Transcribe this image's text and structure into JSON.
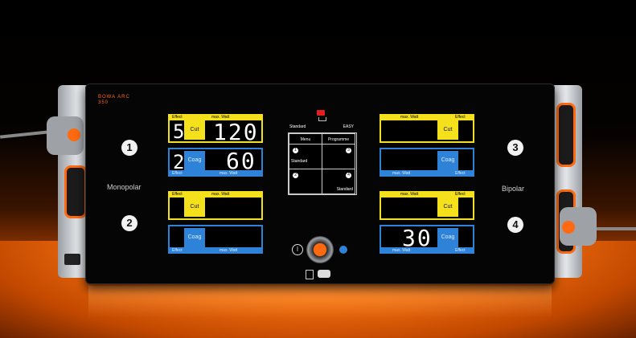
{
  "brand": {
    "logo_text": "BOWA ARC 350"
  },
  "colors": {
    "accent": "#ff6a10",
    "cut": "#f4e11c",
    "coag": "#2e82d8"
  },
  "labels": {
    "monopolar": "Monopolar",
    "bipolar": "Bipolar"
  },
  "sockets": {
    "s1": "1",
    "s2": "2",
    "s3": "3",
    "s4": "4"
  },
  "channels": {
    "ch1": {
      "cut": {
        "effect_label": "Effect",
        "max_watt_label": "max. Watt",
        "mode": "Cut",
        "effect": "5",
        "watt": "120"
      },
      "coag": {
        "effect_label": "Effect",
        "max_watt_label": "max. Watt",
        "mode": "Coag",
        "effect": "2",
        "watt": "60"
      }
    },
    "ch2": {
      "cut": {
        "effect_label": "Effect",
        "max_watt_label": "max. Watt",
        "mode": "Cut"
      },
      "coag": {
        "effect_label": "Effect",
        "max_watt_label": "max. Watt",
        "mode": "Coag"
      }
    },
    "ch3": {
      "cut": {
        "effect_label": "Effect",
        "max_watt_label": "max. Watt",
        "mode": "Cut"
      },
      "coag": {
        "effect_label": "Effect",
        "max_watt_label": "max. Watt",
        "mode": "Coag"
      }
    },
    "ch4": {
      "cut": {
        "effect_label": "Effect",
        "max_watt_label": "max. Watt",
        "mode": "Cut"
      },
      "coag": {
        "effect_label": "Effect",
        "max_watt_label": "max. Watt",
        "mode": "Coag",
        "watt": "30"
      }
    }
  },
  "screen": {
    "header_left": "Standard",
    "header_right": "EASY",
    "menu": "Menu",
    "programmes": "Programme",
    "icon_a": "1",
    "icon_b": "3",
    "icon_c": "2",
    "icon_d": "4",
    "sub_text": "Standard",
    "bottom_text": "Standard"
  },
  "icons": {
    "power": "power-icon",
    "standby": "standby-icon",
    "footswitch": "footswitch-icon"
  }
}
